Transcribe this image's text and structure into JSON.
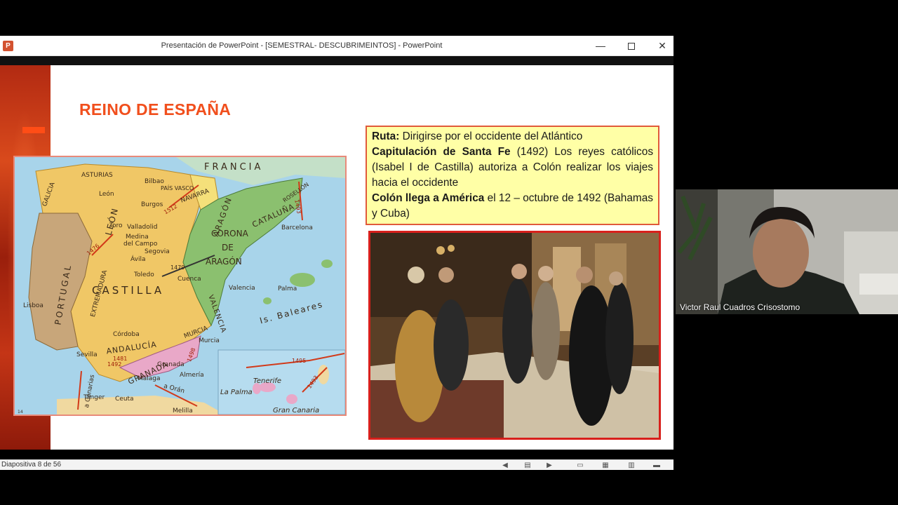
{
  "window": {
    "app_icon_letter": "P",
    "title": "Presentación de PowerPoint - [SEMESTRAL- DESCUBRIMEINTOS] - PowerPoint",
    "minimize_glyph": "—",
    "close_glyph": "✕"
  },
  "slide": {
    "title": "REINO DE ESPAÑA",
    "textbox": {
      "ruta_label": "Ruta:",
      "ruta_text": " Dirigirse por el occidente del Atlántico",
      "capitulacion_label": "Capitulación de Santa Fe",
      "capitulacion_text": " (1492) Los reyes católicos (Isabel I de Castilla) autoriza a Colón realizar los viajes hacia el occidente",
      "colon_label": "Colón llega a América",
      "colon_text": " el 12 – octubre de 1492 (Bahamas y Cuba)"
    },
    "map": {
      "francia": "FRANCIA",
      "asturias": "ASTURIAS",
      "galicia": "GALICIA",
      "bilbao": "Bilbao",
      "pais_vasco": "PAÍS VASCO",
      "navarra": "NAVARRA",
      "burgos": "Burgos",
      "leon_city": "León",
      "leon": "LEÓN",
      "rosellon": "ROSELLÓN",
      "aragon": "ARAGÓN",
      "cataluna": "CATALUÑA",
      "corona": "CORONA",
      "de": "DE",
      "aragon2": "ARAGÓN",
      "barcelona": "Barcelona",
      "toro": "Toro",
      "valladolid": "Valladolid",
      "medina": "Medina",
      "del_campo": "del Campo",
      "segovia": "Segovia",
      "avila": "Ávila",
      "toledo": "Toledo",
      "cuenca": "Cuenca",
      "valencia_city": "Valencia",
      "valencia": "VALENCIA",
      "palma": "Palma",
      "is_baleares": "Is. Baleares",
      "portugal": "PORTUGAL",
      "lisboa": "Lisboa",
      "extremadura": "EXTREMADURA",
      "castilla": "CASTILLA",
      "cordoba": "Córdoba",
      "andalucia": "ANDALUCÍA",
      "murcia": "MURCIA",
      "murcia_city": "Murcia",
      "sevilla": "Sevilla",
      "granada": "GRANADA",
      "granada_city": "Granada",
      "almeria": "Almería",
      "malaga": "Málaga",
      "tanger": "Tánger",
      "ceuta": "Ceuta",
      "melilla": "Melilla",
      "a_oran": "a Orán",
      "a_canarias": "a Canarias",
      "la_palma": "La Palma",
      "tenerife": "Tenerife",
      "gran_canaria": "Gran Canaria",
      "y1512": "1512",
      "y1493": "1493",
      "y1476": "1476",
      "y1479": "1479",
      "y1481": "1481",
      "y1492": "1492",
      "y1498": "1498",
      "y1495": "1495",
      "y1493b": "1493",
      "page_number": "14"
    }
  },
  "statusbar": {
    "slide_count": "Diapositiva 8 de 56"
  },
  "video": {
    "participant_name": "Victor Raul Cuadros Crisostomo"
  },
  "colors": {
    "title": "#f14f1d",
    "textbox_bg": "#ffffa6",
    "castilla": "#f0c766",
    "aragon": "#8bc06f",
    "portugal": "#c8a67a",
    "granada": "#e9a8c8",
    "sea": "#a8d4ea"
  }
}
